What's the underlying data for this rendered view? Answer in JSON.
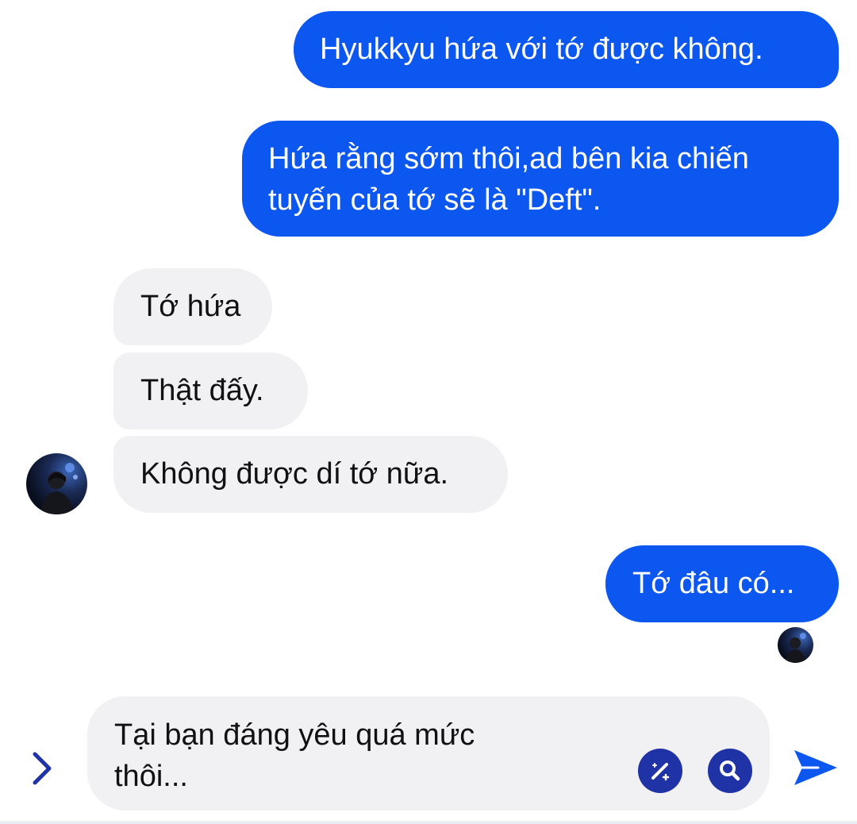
{
  "messages": [
    {
      "side": "outgoing",
      "text": "Hyukkyu hứa với tớ được không."
    },
    {
      "side": "outgoing",
      "lines": [
        "Hứa rằng sớm thôi,ad bên kia chiến",
        "tuyến của tớ sẽ là \"Deft\"."
      ]
    },
    {
      "side": "incoming",
      "text": "Tớ hứa"
    },
    {
      "side": "incoming",
      "text": "Thật đấy."
    },
    {
      "side": "incoming",
      "text": "Không được dí tớ nữa."
    },
    {
      "side": "outgoing",
      "text": "Tớ đâu có..."
    }
  ],
  "composer": {
    "draft": "Tại bạn đáng yêu quá mức\nthôi...",
    "icons": {
      "expand": "chevron-right-icon",
      "edit": "magic-pen-icon",
      "search": "search-icon",
      "send": "send-icon"
    }
  },
  "colors": {
    "outgoing_bubble": "#0b57f0",
    "incoming_bubble": "#f1f1f4",
    "accent_dark": "#1f33a6",
    "send": "#0b57f0"
  }
}
